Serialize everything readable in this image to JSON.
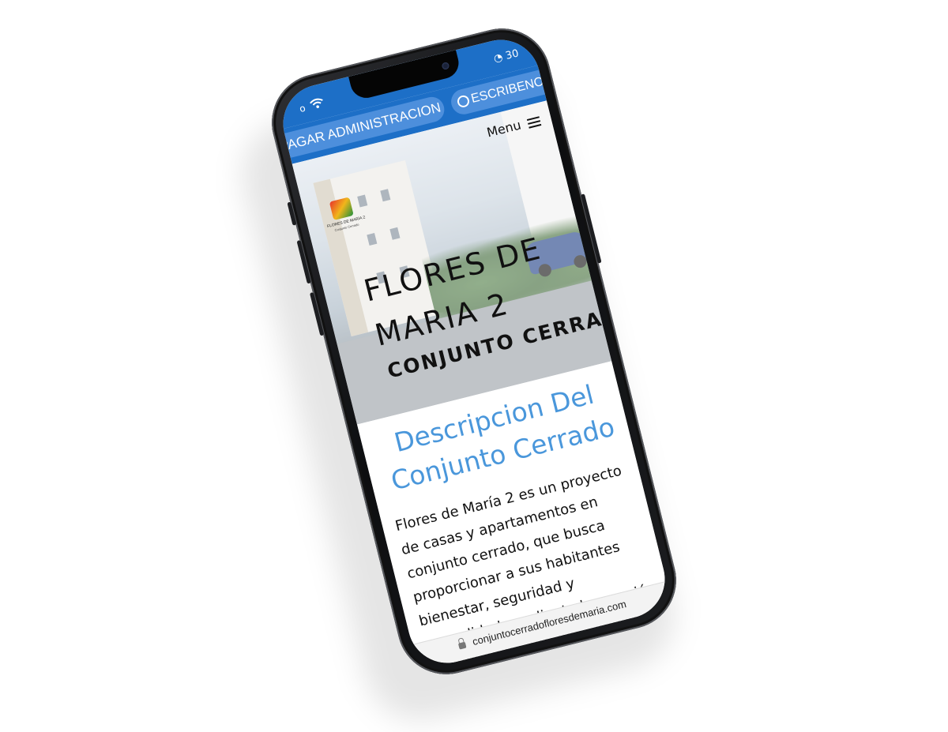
{
  "status_bar": {
    "signal": "o",
    "battery_text": "30"
  },
  "top_buttons": {
    "pagar_label": "PAGAR ADMINISTRACION",
    "escribe_label": "ESCRIBENOS"
  },
  "header": {
    "menu_label": "Menu",
    "logo_text": "FLORES DE MARÍA",
    "logo_number": "2",
    "logo_sub": "Conjunto Cerrado"
  },
  "hero": {
    "title_line1": "FLORES DE",
    "title_line2": "MARIA 2",
    "subtitle": "CONJUNTO CERRADO"
  },
  "content": {
    "section_title_line1": "Descripcion Del",
    "section_title_line2": "Conjunto Cerrado",
    "description": "Flores de María 2 es un proyecto de casas y apartamentos en conjunto cerrado, que busca proporcionar a sus habitantes bienestar, seguridad y comodidad, mediante la creación de ambientes urbanos amplios"
  },
  "browser": {
    "url": "conjuntocerradofloresdemaria.com"
  },
  "colors": {
    "primary_blue": "#1d6fc7",
    "button_blue": "#4d8fdc",
    "title_blue": "#4a97db"
  }
}
